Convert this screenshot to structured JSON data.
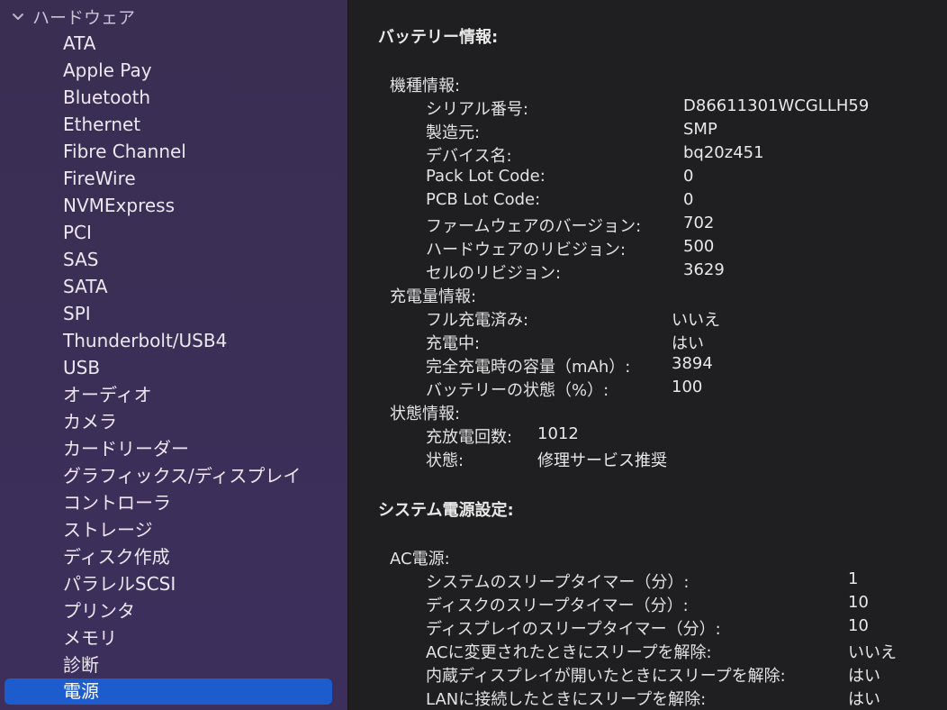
{
  "sidebar": {
    "group_label": "ハードウェア",
    "items": [
      {
        "label": "ATA"
      },
      {
        "label": "Apple Pay"
      },
      {
        "label": "Bluetooth"
      },
      {
        "label": "Ethernet"
      },
      {
        "label": "Fibre Channel"
      },
      {
        "label": "FireWire"
      },
      {
        "label": "NVMExpress"
      },
      {
        "label": "PCI"
      },
      {
        "label": "SAS"
      },
      {
        "label": "SATA"
      },
      {
        "label": "SPI"
      },
      {
        "label": "Thunderbolt/USB4"
      },
      {
        "label": "USB"
      },
      {
        "label": "オーディオ"
      },
      {
        "label": "カメラ"
      },
      {
        "label": "カードリーダー"
      },
      {
        "label": "グラフィックス/ディスプレイ"
      },
      {
        "label": "コントローラ"
      },
      {
        "label": "ストレージ"
      },
      {
        "label": "ディスク作成"
      },
      {
        "label": "パラレルSCSI"
      },
      {
        "label": "プリンタ"
      },
      {
        "label": "メモリ"
      },
      {
        "label": "診断"
      },
      {
        "label": "電源"
      }
    ],
    "selected": "電源"
  },
  "content": {
    "battery_title": "バッテリー情報:",
    "model_info": {
      "heading": "機種情報:",
      "rows": [
        {
          "label": "シリアル番号:",
          "value": "D86611301WCGLLH59"
        },
        {
          "label": "製造元:",
          "value": "SMP"
        },
        {
          "label": "デバイス名:",
          "value": "bq20z451"
        },
        {
          "label": "Pack Lot Code:",
          "value": "0"
        },
        {
          "label": "PCB Lot Code:",
          "value": "0"
        },
        {
          "label": "ファームウェアのバージョン:",
          "value": "702"
        },
        {
          "label": "ハードウェアのリビジョン:",
          "value": "500"
        },
        {
          "label": "セルのリビジョン:",
          "value": "3629"
        }
      ]
    },
    "charge_info": {
      "heading": "充電量情報:",
      "rows": [
        {
          "label": "フル充電済み:",
          "value": "いいえ"
        },
        {
          "label": "充電中:",
          "value": "はい"
        },
        {
          "label": "完全充電時の容量（mAh）:",
          "value": "3894"
        },
        {
          "label": "バッテリーの状態（%）:",
          "value": "100"
        }
      ]
    },
    "health_info": {
      "heading": "状態情報:",
      "rows": [
        {
          "label": "充放電回数:",
          "value": "1012"
        },
        {
          "label": "状態:",
          "value": "修理サービス推奨"
        }
      ]
    },
    "power_title": "システム電源設定:",
    "ac_power": {
      "heading": "AC電源:",
      "rows": [
        {
          "label": "システムのスリープタイマー（分）:",
          "value": "1"
        },
        {
          "label": "ディスクのスリープタイマー（分）:",
          "value": "10"
        },
        {
          "label": "ディスプレイのスリープタイマー（分）:",
          "value": "10"
        },
        {
          "label": "ACに変更されたときにスリープを解除:",
          "value": "いいえ"
        },
        {
          "label": "内蔵ディスプレイが開いたときにスリープを解除:",
          "value": "はい"
        },
        {
          "label": "LANに接続したときにスリープを解除:",
          "value": "はい"
        }
      ]
    }
  }
}
